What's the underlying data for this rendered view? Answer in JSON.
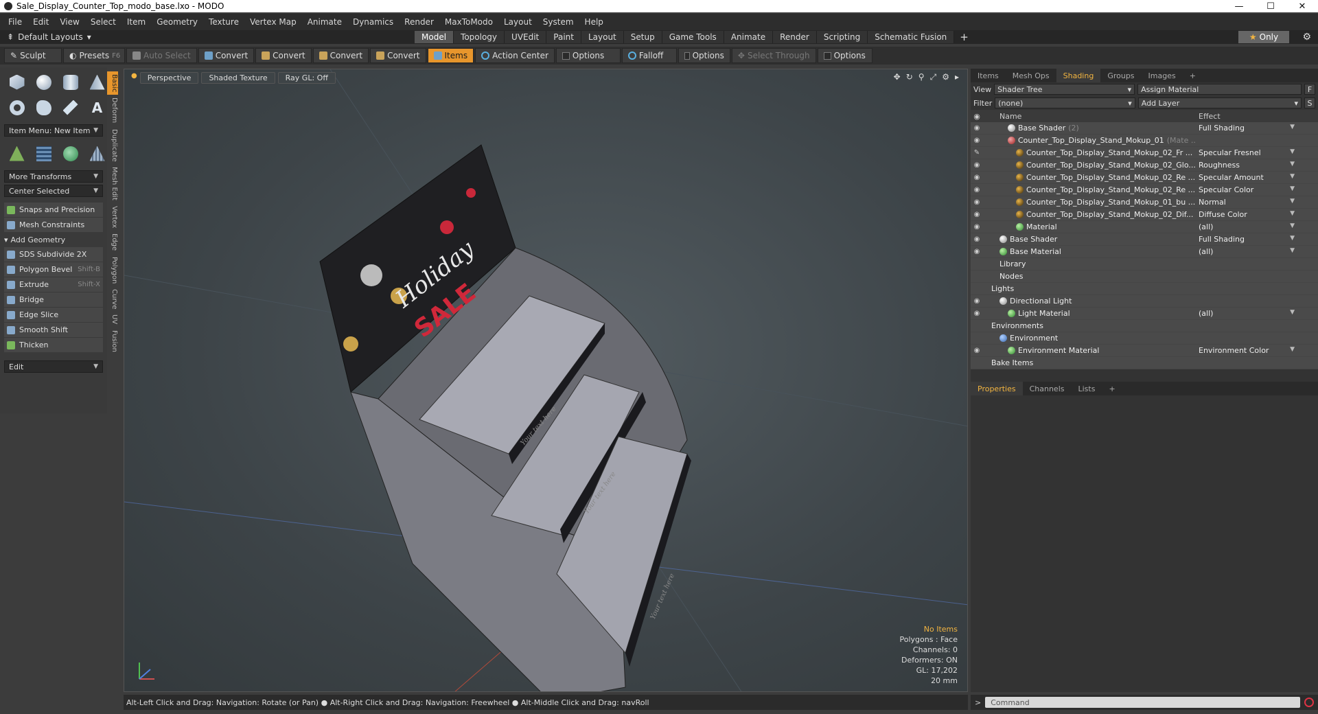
{
  "window": {
    "title": "Sale_Display_Counter_Top_modo_base.lxo - MODO",
    "min": "—",
    "max": "☐",
    "close": "✕"
  },
  "menu": [
    "File",
    "Edit",
    "View",
    "Select",
    "Item",
    "Geometry",
    "Texture",
    "Vertex Map",
    "Animate",
    "Dynamics",
    "Render",
    "MaxToModo",
    "Layout",
    "System",
    "Help"
  ],
  "layouts": {
    "default_label": "Default Layouts",
    "tabs": [
      "Model",
      "Topology",
      "UVEdit",
      "Paint",
      "Layout",
      "Setup",
      "Game Tools",
      "Animate",
      "Render",
      "Scripting",
      "Schematic Fusion"
    ],
    "active_tab": "Model",
    "only_label": "Only"
  },
  "toolbar": {
    "sculpt": "Sculpt",
    "presets": "Presets",
    "presets_key": "F6",
    "auto_select": "Auto Select",
    "convert": "Convert",
    "items": "Items",
    "action_center": "Action Center",
    "options": "Options",
    "falloff": "Falloff",
    "select_through": "Select Through"
  },
  "left": {
    "item_menu": "Item Menu: New Item",
    "more_transforms": "More Transforms",
    "center_selected": "Center Selected",
    "snaps": "Snaps and Precision",
    "mesh_constraints": "Mesh Constraints",
    "add_geometry": "Add Geometry",
    "tools": [
      {
        "label": "SDS Subdivide 2X",
        "shortcut": ""
      },
      {
        "label": "Polygon Bevel",
        "shortcut": "Shift-B"
      },
      {
        "label": "Extrude",
        "shortcut": "Shift-X"
      },
      {
        "label": "Bridge",
        "shortcut": ""
      },
      {
        "label": "Edge Slice",
        "shortcut": ""
      },
      {
        "label": "Smooth Shift",
        "shortcut": ""
      },
      {
        "label": "Thicken",
        "shortcut": ""
      }
    ],
    "edit": "Edit",
    "vtabs": [
      "Basic",
      "Deform",
      "Duplicate",
      "Mesh Edit",
      "Vertex",
      "Edge",
      "Polygon",
      "Curve",
      "UV",
      "Fusion"
    ]
  },
  "viewport": {
    "perspective": "Perspective",
    "shaded": "Shaded Texture",
    "raygl": "Ray GL: Off",
    "holiday_text": "Holiday",
    "sale_text": "SALE",
    "shelf_text": "Your text here",
    "info": {
      "no_items": "No Items",
      "polygons": "Polygons : Face",
      "channels": "Channels: 0",
      "deformers": "Deformers: ON",
      "gl": "GL: 17,202",
      "scale": "20 mm"
    }
  },
  "status": "Alt-Left Click and Drag: Navigation: Rotate (or Pan) ● Alt-Right Click and Drag: Navigation: Freewheel ● Alt-Middle Click and Drag: navRoll",
  "right": {
    "tabs": [
      "Items",
      "Mesh Ops",
      "Shading",
      "Groups",
      "Images"
    ],
    "active_tab": "Shading",
    "view_label": "View",
    "view_value": "Shader Tree",
    "assign_material": "Assign Material",
    "f_btn": "F",
    "filter_label": "Filter",
    "filter_value": "(none)",
    "add_layer": "Add Layer",
    "s_btn": "S",
    "col_name": "Name",
    "col_effect": "Effect",
    "rows": [
      {
        "name": "Base Shader",
        "suffix": "(2)",
        "effect": "Full Shading",
        "indent": 3,
        "icon": "white",
        "eye": "◉"
      },
      {
        "name": "Counter_Top_Display_Stand_Mokup_01",
        "suffix": "(Mate ...",
        "effect": "",
        "indent": 3,
        "icon": "red",
        "eye": "◉"
      },
      {
        "name": "Counter_Top_Display_Stand_Mokup_02_Fr ...",
        "suffix": "",
        "effect": "Specular Fresnel",
        "indent": 4,
        "icon": "ball",
        "eye": "✎"
      },
      {
        "name": "Counter_Top_Display_Stand_Mokup_02_Glo...",
        "suffix": "",
        "effect": "Roughness",
        "indent": 4,
        "icon": "ball",
        "eye": "◉"
      },
      {
        "name": "Counter_Top_Display_Stand_Mokup_02_Re ...",
        "suffix": "",
        "effect": "Specular Amount",
        "indent": 4,
        "icon": "ball",
        "eye": "◉"
      },
      {
        "name": "Counter_Top_Display_Stand_Mokup_02_Re ...",
        "suffix": "",
        "effect": "Specular Color",
        "indent": 4,
        "icon": "ball",
        "eye": "◉"
      },
      {
        "name": "Counter_Top_Display_Stand_Mokup_01_bu ...",
        "suffix": "",
        "effect": "Normal",
        "indent": 4,
        "icon": "ball",
        "eye": "◉"
      },
      {
        "name": "Counter_Top_Display_Stand_Mokup_02_Dif...",
        "suffix": "",
        "effect": "Diffuse Color",
        "indent": 4,
        "icon": "ball",
        "eye": "◉"
      },
      {
        "name": "Material",
        "suffix": "",
        "effect": "(all)",
        "indent": 4,
        "icon": "green",
        "eye": "◉"
      },
      {
        "name": "Base Shader",
        "suffix": "",
        "effect": "Full Shading",
        "indent": 2,
        "icon": "white",
        "eye": "◉"
      },
      {
        "name": "Base Material",
        "suffix": "",
        "effect": "(all)",
        "indent": 2,
        "icon": "green",
        "eye": "◉"
      },
      {
        "name": "Library",
        "suffix": "",
        "effect": "",
        "indent": 2,
        "icon": "none",
        "eye": ""
      },
      {
        "name": "Nodes",
        "suffix": "",
        "effect": "",
        "indent": 2,
        "icon": "none",
        "eye": ""
      },
      {
        "name": "Lights",
        "suffix": "",
        "effect": "",
        "indent": 1,
        "icon": "none",
        "eye": ""
      },
      {
        "name": "Directional Light",
        "suffix": "",
        "effect": "",
        "indent": 2,
        "icon": "white",
        "eye": "◉"
      },
      {
        "name": "Light Material",
        "suffix": "",
        "effect": "(all)",
        "indent": 3,
        "icon": "green",
        "eye": "◉"
      },
      {
        "name": "Environments",
        "suffix": "",
        "effect": "",
        "indent": 1,
        "icon": "none",
        "eye": ""
      },
      {
        "name": "Environment",
        "suffix": "",
        "effect": "",
        "indent": 2,
        "icon": "blue",
        "eye": ""
      },
      {
        "name": "Environment Material",
        "suffix": "",
        "effect": "Environment Color",
        "indent": 3,
        "icon": "green",
        "eye": "◉"
      },
      {
        "name": "Bake Items",
        "suffix": "",
        "effect": "",
        "indent": 1,
        "icon": "none",
        "eye": ""
      }
    ],
    "props_tabs": [
      "Properties",
      "Channels",
      "Lists"
    ],
    "props_active": "Properties",
    "command_placeholder": "Command"
  }
}
